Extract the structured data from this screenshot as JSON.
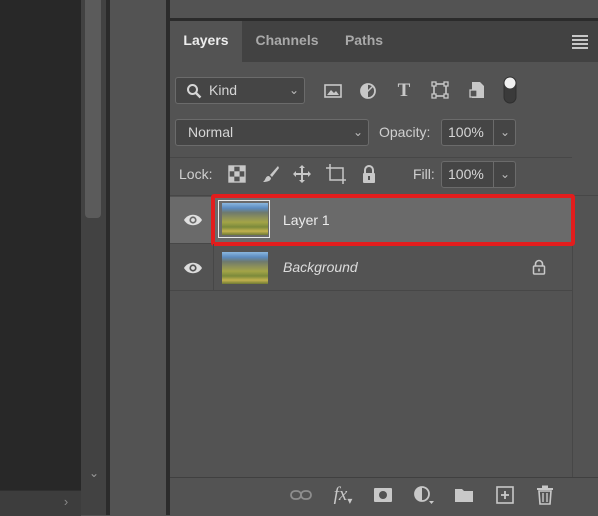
{
  "tabs": [
    {
      "label": "Layers",
      "active": true
    },
    {
      "label": "Channels",
      "active": false
    },
    {
      "label": "Paths",
      "active": false
    }
  ],
  "filter": {
    "kind_label": "Kind"
  },
  "blend_mode": {
    "value": "Normal"
  },
  "opacity": {
    "label": "Opacity:",
    "value": "100%"
  },
  "lock": {
    "label": "Lock:"
  },
  "fill": {
    "label": "Fill:",
    "value": "100%"
  },
  "layers": [
    {
      "name": "Layer 1",
      "selected": true,
      "visible": true,
      "locked": false
    },
    {
      "name": "Background",
      "selected": false,
      "visible": true,
      "locked": true
    }
  ],
  "colors": {
    "selection_outline": "#e21d1d",
    "selected_row": "#6a6a6a",
    "panel_bg": "#535353",
    "canvas_bg": "#282828"
  },
  "icons": {
    "filter_icons": [
      "image-filter-icon",
      "adjustment-filter-icon",
      "type-filter-icon",
      "shape-filter-icon",
      "smart-object-filter-icon",
      "filter-toggle-icon"
    ],
    "lock_icons": [
      "lock-transparent-pixels-icon",
      "lock-image-pixels-icon",
      "lock-position-icon",
      "lock-artboard-icon",
      "lock-all-icon"
    ],
    "bottom_icons": [
      "link-layers-icon",
      "layer-style-icon",
      "add-mask-icon",
      "adjustment-layer-icon",
      "group-icon",
      "new-layer-icon",
      "delete-layer-icon"
    ]
  }
}
